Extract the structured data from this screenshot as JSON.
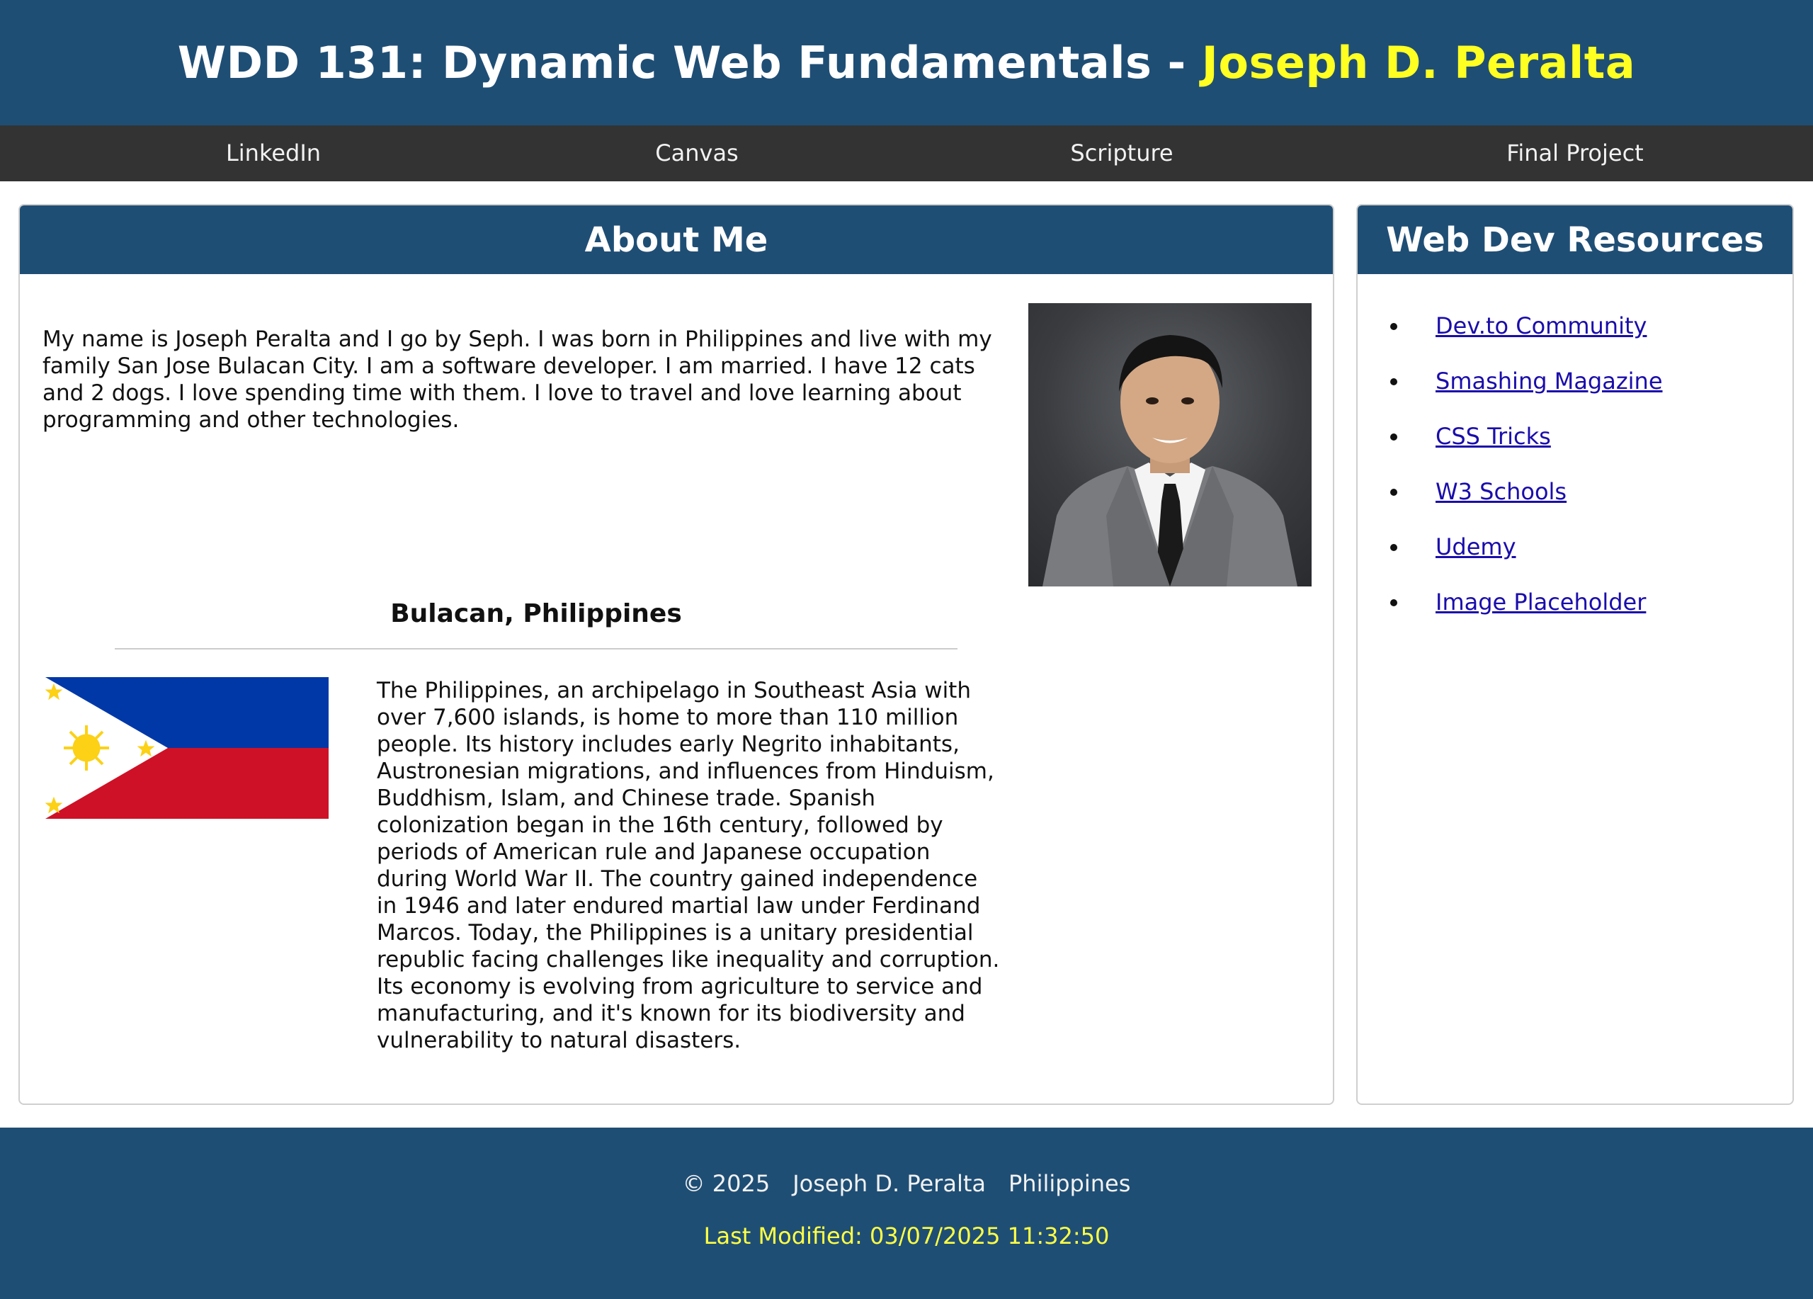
{
  "header": {
    "title": "WDD 131: Dynamic Web Fundamentals - ",
    "name": "Joseph D. Peralta"
  },
  "nav": {
    "items": [
      {
        "label": "LinkedIn"
      },
      {
        "label": "Canvas"
      },
      {
        "label": "Scripture"
      },
      {
        "label": "Final Project"
      }
    ]
  },
  "about": {
    "heading": "About Me",
    "intro": "My name is Joseph Peralta and I go by Seph. I was born in Philippines and live with my family San Jose Bulacan City. I am a software developer. I am married. I have 12 cats and 2 dogs. I love spending time with them. I love to travel and love learning about programming and other technologies.",
    "region_title": "Bulacan, Philippines",
    "history": "The Philippines, an archipelago in Southeast Asia with over 7,600 islands, is home to more than 110 million people. Its history includes early Negrito inhabitants, Austronesian migrations, and influences from Hinduism, Buddhism, Islam, and Chinese trade. Spanish colonization began in the 16th century, followed by periods of American rule and Japanese occupation during World War II. The country gained independence in 1946 and later endured martial law under Ferdinand Marcos. Today, the Philippines is a unitary presidential republic facing challenges like inequality and corruption. Its economy is evolving from agriculture to service and manufacturing, and it's known for its biodiversity and vulnerability to natural disasters."
  },
  "resources": {
    "heading": "Web Dev Resources",
    "links": [
      {
        "label": "Dev.to Community"
      },
      {
        "label": "Smashing Magazine"
      },
      {
        "label": "CSS Tricks"
      },
      {
        "label": "W3 Schools"
      },
      {
        "label": "Udemy"
      },
      {
        "label": "Image Placeholder"
      }
    ]
  },
  "footer": {
    "copyright": "© 2025",
    "author": "Joseph D. Peralta",
    "country": "Philippines",
    "last_modified": "Last Modified: 03/07/2025 11:32:50"
  },
  "colors": {
    "primary": "#1f4e75",
    "nav": "#333333",
    "accent": "#ffff22",
    "link": "#1a0dab"
  }
}
